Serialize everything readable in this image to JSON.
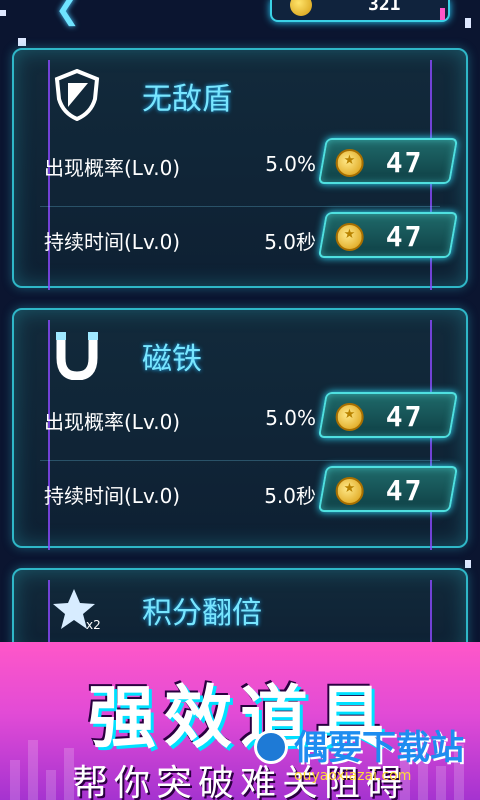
{
  "header": {
    "score": "321"
  },
  "panels": [
    {
      "title": "无敌盾",
      "icon": "shield-icon",
      "rows": [
        {
          "label": "出现概率(Lv.0)",
          "value": "5.0%",
          "price": "47"
        },
        {
          "label": "持续时间(Lv.0)",
          "value": "5.0秒",
          "price": "47"
        }
      ]
    },
    {
      "title": "磁铁",
      "icon": "magnet-icon",
      "rows": [
        {
          "label": "出现概率(Lv.0)",
          "value": "5.0%",
          "price": "47"
        },
        {
          "label": "持续时间(Lv.0)",
          "value": "5.0秒",
          "price": "47"
        }
      ]
    },
    {
      "title": "积分翻倍",
      "icon": "double-score-star-icon",
      "icon_text": "x2"
    }
  ],
  "banner": {
    "title": "强效道具",
    "subtitle": "帮你突破难关阻碍"
  },
  "watermark": {
    "text": "偶要下载站",
    "url": "ouyaoxiazai.com"
  },
  "colors": {
    "accent": "#2fb7c8",
    "title": "#78e6ff",
    "banner": "#ff57c8",
    "purple_line": "#8b49ff"
  }
}
